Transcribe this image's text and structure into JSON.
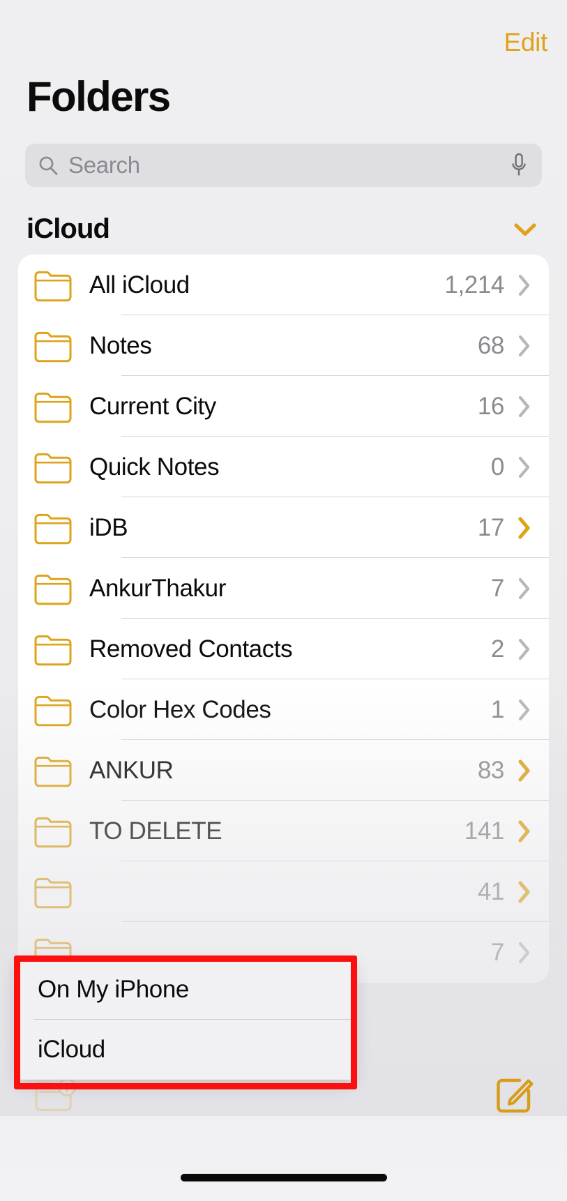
{
  "app": {
    "name": "Notes",
    "accent_color": "#e0a21a",
    "annotation_color": "#fb0f0f"
  },
  "navbar": {
    "edit_label": "Edit"
  },
  "header": {
    "title": "Folders"
  },
  "search": {
    "placeholder": "Search",
    "value": "",
    "icon": "search-icon",
    "mic_icon": "microphone-icon"
  },
  "section": {
    "title": "iCloud",
    "chevron_icon": "chevron-down-icon",
    "expanded": true
  },
  "folders": [
    {
      "name": "All iCloud",
      "count": "1,214",
      "chevron": "gray"
    },
    {
      "name": "Notes",
      "count": "68",
      "chevron": "gray"
    },
    {
      "name": "Current City",
      "count": "16",
      "chevron": "gray"
    },
    {
      "name": "Quick Notes",
      "count": "0",
      "chevron": "gray"
    },
    {
      "name": "iDB",
      "count": "17",
      "chevron": "yellow"
    },
    {
      "name": "AnkurThakur",
      "count": "7",
      "chevron": "gray"
    },
    {
      "name": "Removed Contacts",
      "count": "2",
      "chevron": "gray"
    },
    {
      "name": "Color Hex Codes",
      "count": "1",
      "chevron": "gray"
    },
    {
      "name": "ANKUR",
      "count": "83",
      "chevron": "yellow"
    },
    {
      "name": "TO DELETE",
      "count": "141",
      "chevron": "yellow"
    },
    {
      "name": "",
      "count": "41",
      "chevron": "yellow"
    },
    {
      "name": "",
      "count": "7",
      "chevron": "gray"
    }
  ],
  "popup_menu": {
    "items": [
      {
        "label": "On My iPhone"
      },
      {
        "label": "iCloud"
      }
    ]
  },
  "toolbar": {
    "new_folder_icon": "new-folder-icon",
    "compose_icon": "compose-note-icon"
  }
}
